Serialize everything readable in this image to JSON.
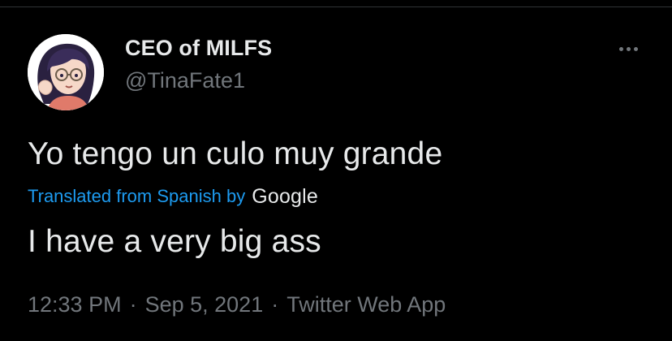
{
  "colors": {
    "background": "#000000",
    "primary_text": "#e7e9ea",
    "secondary_text": "#71767b",
    "accent": "#1d9bf0",
    "divider": "#2f3336"
  },
  "author": {
    "display_name": "CEO of MILFS",
    "handle": "@TinaFate1",
    "avatar_icon": "cartoon-woman-avatar"
  },
  "more_icon": "more-horizontal-icon",
  "tweet": {
    "text": "Yo tengo un culo muy grande",
    "translation_label": "Translated from Spanish by",
    "translation_provider": "Google",
    "translated_text": "I have a very big ass"
  },
  "meta": {
    "time": "12:33 PM",
    "separator": "·",
    "date": "Sep 5, 2021",
    "source": "Twitter Web App"
  }
}
